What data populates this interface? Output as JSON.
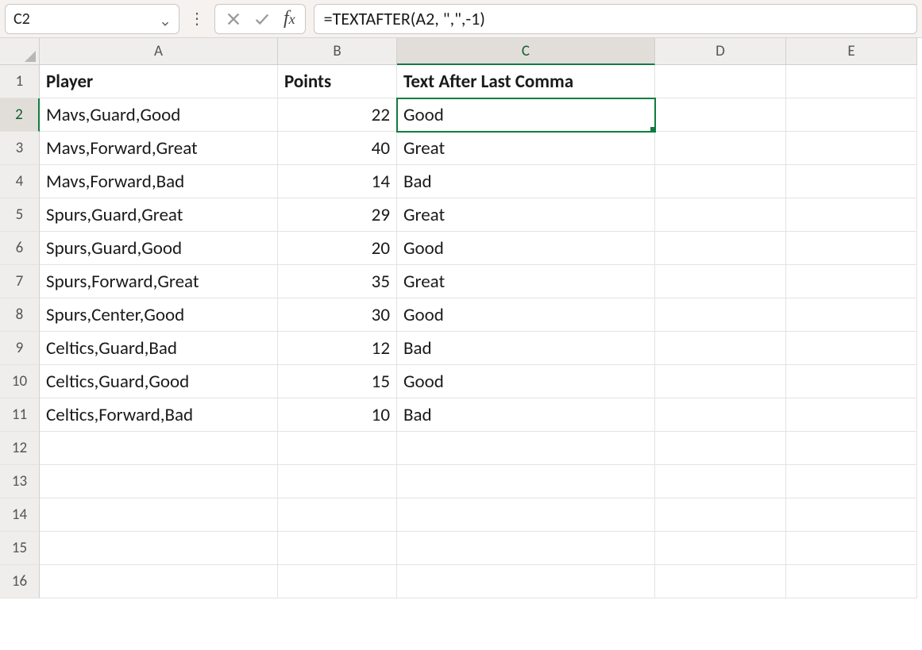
{
  "namebox": {
    "value": "C2"
  },
  "formula": {
    "value": "=TEXTAFTER(A2, \",\",-1)"
  },
  "columns": [
    "A",
    "B",
    "C",
    "D",
    "E"
  ],
  "active_column": "C",
  "active_row": 2,
  "total_rows": 16,
  "headers": {
    "A": "Player",
    "B": "Points",
    "C": "Text After Last Comma"
  },
  "rows": [
    {
      "player": "Mavs,Guard,Good",
      "points": 22,
      "after": "Good"
    },
    {
      "player": "Mavs,Forward,Great",
      "points": 40,
      "after": "Great"
    },
    {
      "player": "Mavs,Forward,Bad",
      "points": 14,
      "after": "Bad"
    },
    {
      "player": "Spurs,Guard,Great",
      "points": 29,
      "after": "Great"
    },
    {
      "player": "Spurs,Guard,Good",
      "points": 20,
      "after": "Good"
    },
    {
      "player": "Spurs,Forward,Great",
      "points": 35,
      "after": "Great"
    },
    {
      "player": "Spurs,Center,Good",
      "points": 30,
      "after": "Good"
    },
    {
      "player": "Celtics,Guard,Bad",
      "points": 12,
      "after": "Bad"
    },
    {
      "player": "Celtics,Guard,Good",
      "points": 15,
      "after": "Good"
    },
    {
      "player": "Celtics,Forward,Bad",
      "points": 10,
      "after": "Bad"
    }
  ]
}
